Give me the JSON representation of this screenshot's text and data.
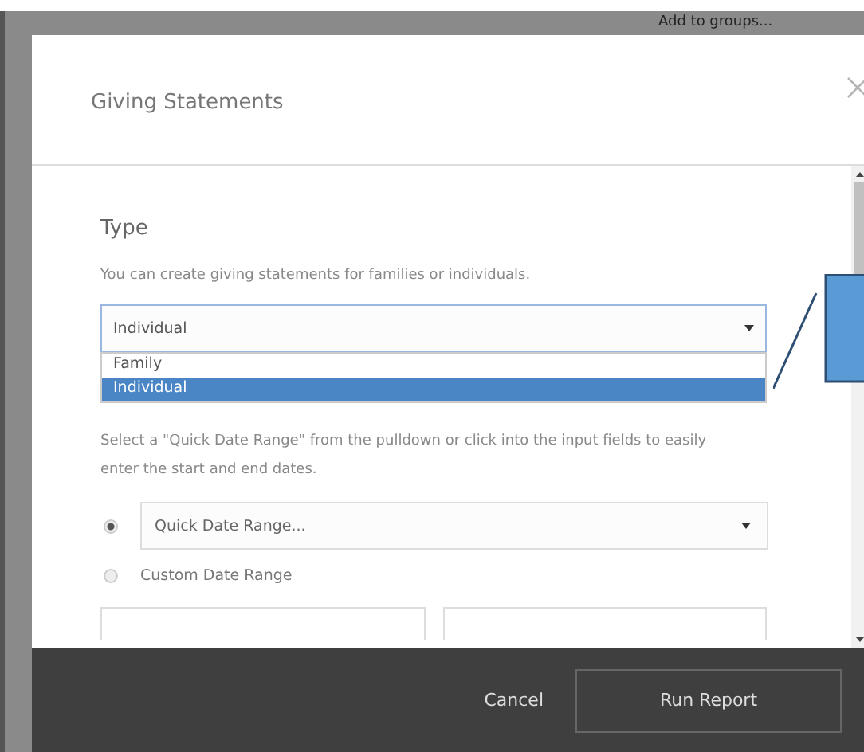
{
  "backdrop": {
    "link": "Add to groups..."
  },
  "modal": {
    "title": "Giving Statements",
    "type_section": {
      "heading": "Type",
      "description": "You can create giving statements for families or individuals.",
      "select": {
        "value": "Individual",
        "expanded": true
      },
      "options": [
        {
          "label": "Family",
          "selected": false
        },
        {
          "label": "Individual",
          "selected": true
        }
      ]
    },
    "date_section": {
      "description": "Select a \"Quick Date Range\" from the pulldown or click into the input fields to easily enter the start and end dates.",
      "choices": [
        {
          "kind": "select",
          "selected": true,
          "placeholder": "Quick Date Range..."
        },
        {
          "kind": "label",
          "selected": false,
          "label": "Custom Date Range"
        }
      ]
    },
    "footer": {
      "cancel": "Cancel",
      "submit": "Run Report"
    }
  }
}
